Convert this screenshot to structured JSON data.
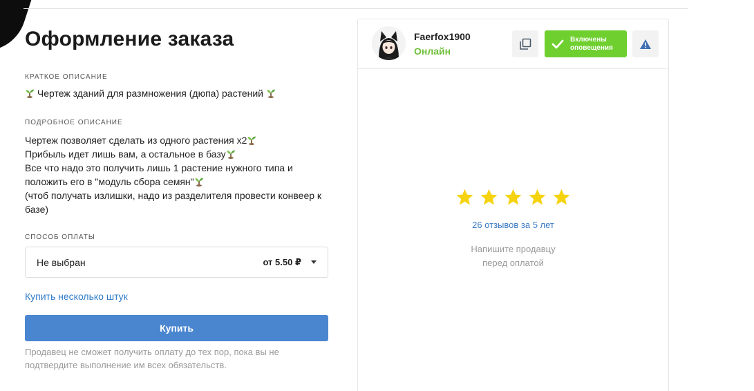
{
  "page": {
    "title": "Оформление заказа"
  },
  "short_description": {
    "label": "КРАТКОЕ ОПИСАНИЕ",
    "text": "Чертеж зданий для размножения (дюпа) растений"
  },
  "full_description": {
    "label": "ПОДРОБНОЕ ОПИСАНИЕ",
    "lines": [
      "Чертеж позволяет сделать из одного растения x2",
      "Прибыль идет лишь вам, а остальное в базу",
      "Все что надо это получить лишь 1 растение нужного типа и",
      "положить его в \"модуль сбора семян\"",
      "(чтоб получать излишки, надо из разделителя провести конвеер к",
      "базе)"
    ]
  },
  "payment": {
    "label": "СПОСОБ ОПЛАТЫ",
    "selected": "Не выбран",
    "price": "от 5.50 ₽"
  },
  "multi_link": "Купить несколько штук",
  "buy_button": "Купить",
  "buy_note_lines": [
    "Продавец не сможет получить оплату до тех пор, пока вы не",
    "подтвердите выполнение им всех обязательств."
  ],
  "seller": {
    "name": "Faerfox1900",
    "status": "Онлайн",
    "notify_line1": "Включены",
    "notify_line2": "оповещения",
    "rating_stars": 5,
    "reviews": "26 отзывов за 5 лет",
    "hint_line1": "Напишите продавцу",
    "hint_line2": "перед оплатой"
  },
  "colors": {
    "accent_blue": "#4a86d0",
    "link_blue": "#2f7bc9",
    "online_green": "#6fc03a",
    "notify_green": "#6fcf2f",
    "star_yellow": "#f5d30f"
  },
  "icons": [
    "sprout-icon",
    "chevron-down-icon",
    "copy-icon",
    "check-icon",
    "warning-icon",
    "star-icon"
  ]
}
